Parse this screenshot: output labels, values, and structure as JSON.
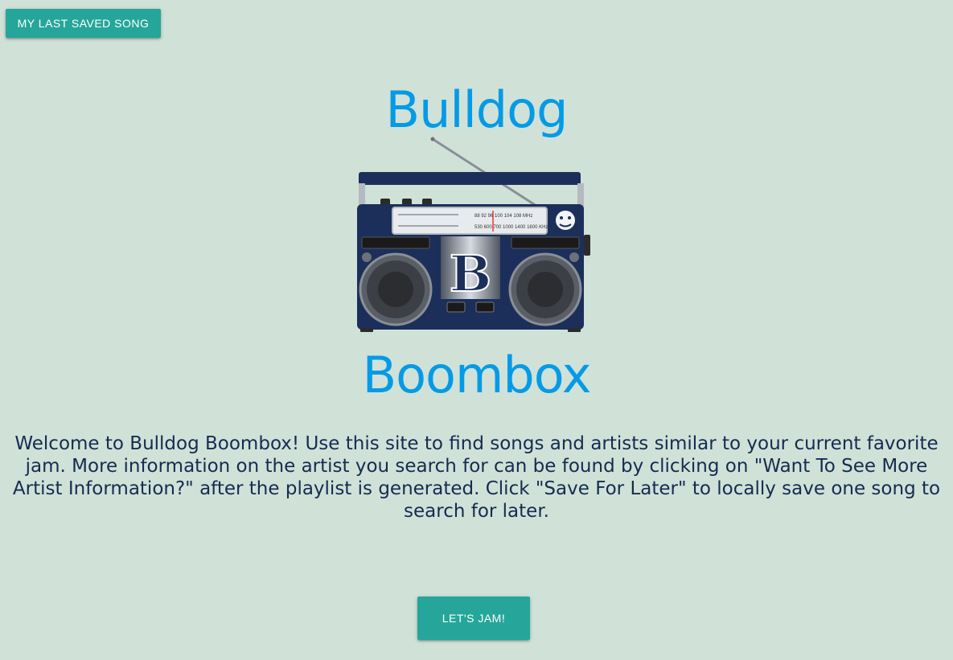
{
  "header": {
    "saved_song_button": "MY LAST SAVED SONG"
  },
  "hero": {
    "title_top": "Bulldog",
    "title_bottom": "Boombox",
    "logo_icon": "boombox-radio-icon",
    "logo_letter": "B"
  },
  "intro": {
    "text": "Welcome to Bulldog Boombox! Use this site to find songs and artists similar to your current favorite jam. More information on the artist you search for can be found by clicking on \"Want To See More Artist Information?\" after the playlist is generated. Click \"Save For Later\" to locally save one song to search for later."
  },
  "actions": {
    "jam_button": "LET'S JAM!"
  },
  "colors": {
    "background": "#d0e1d8",
    "button": "#26a69a",
    "title": "#039be5",
    "text": "#152c4f",
    "boombox_body": "#1c2f5a"
  }
}
